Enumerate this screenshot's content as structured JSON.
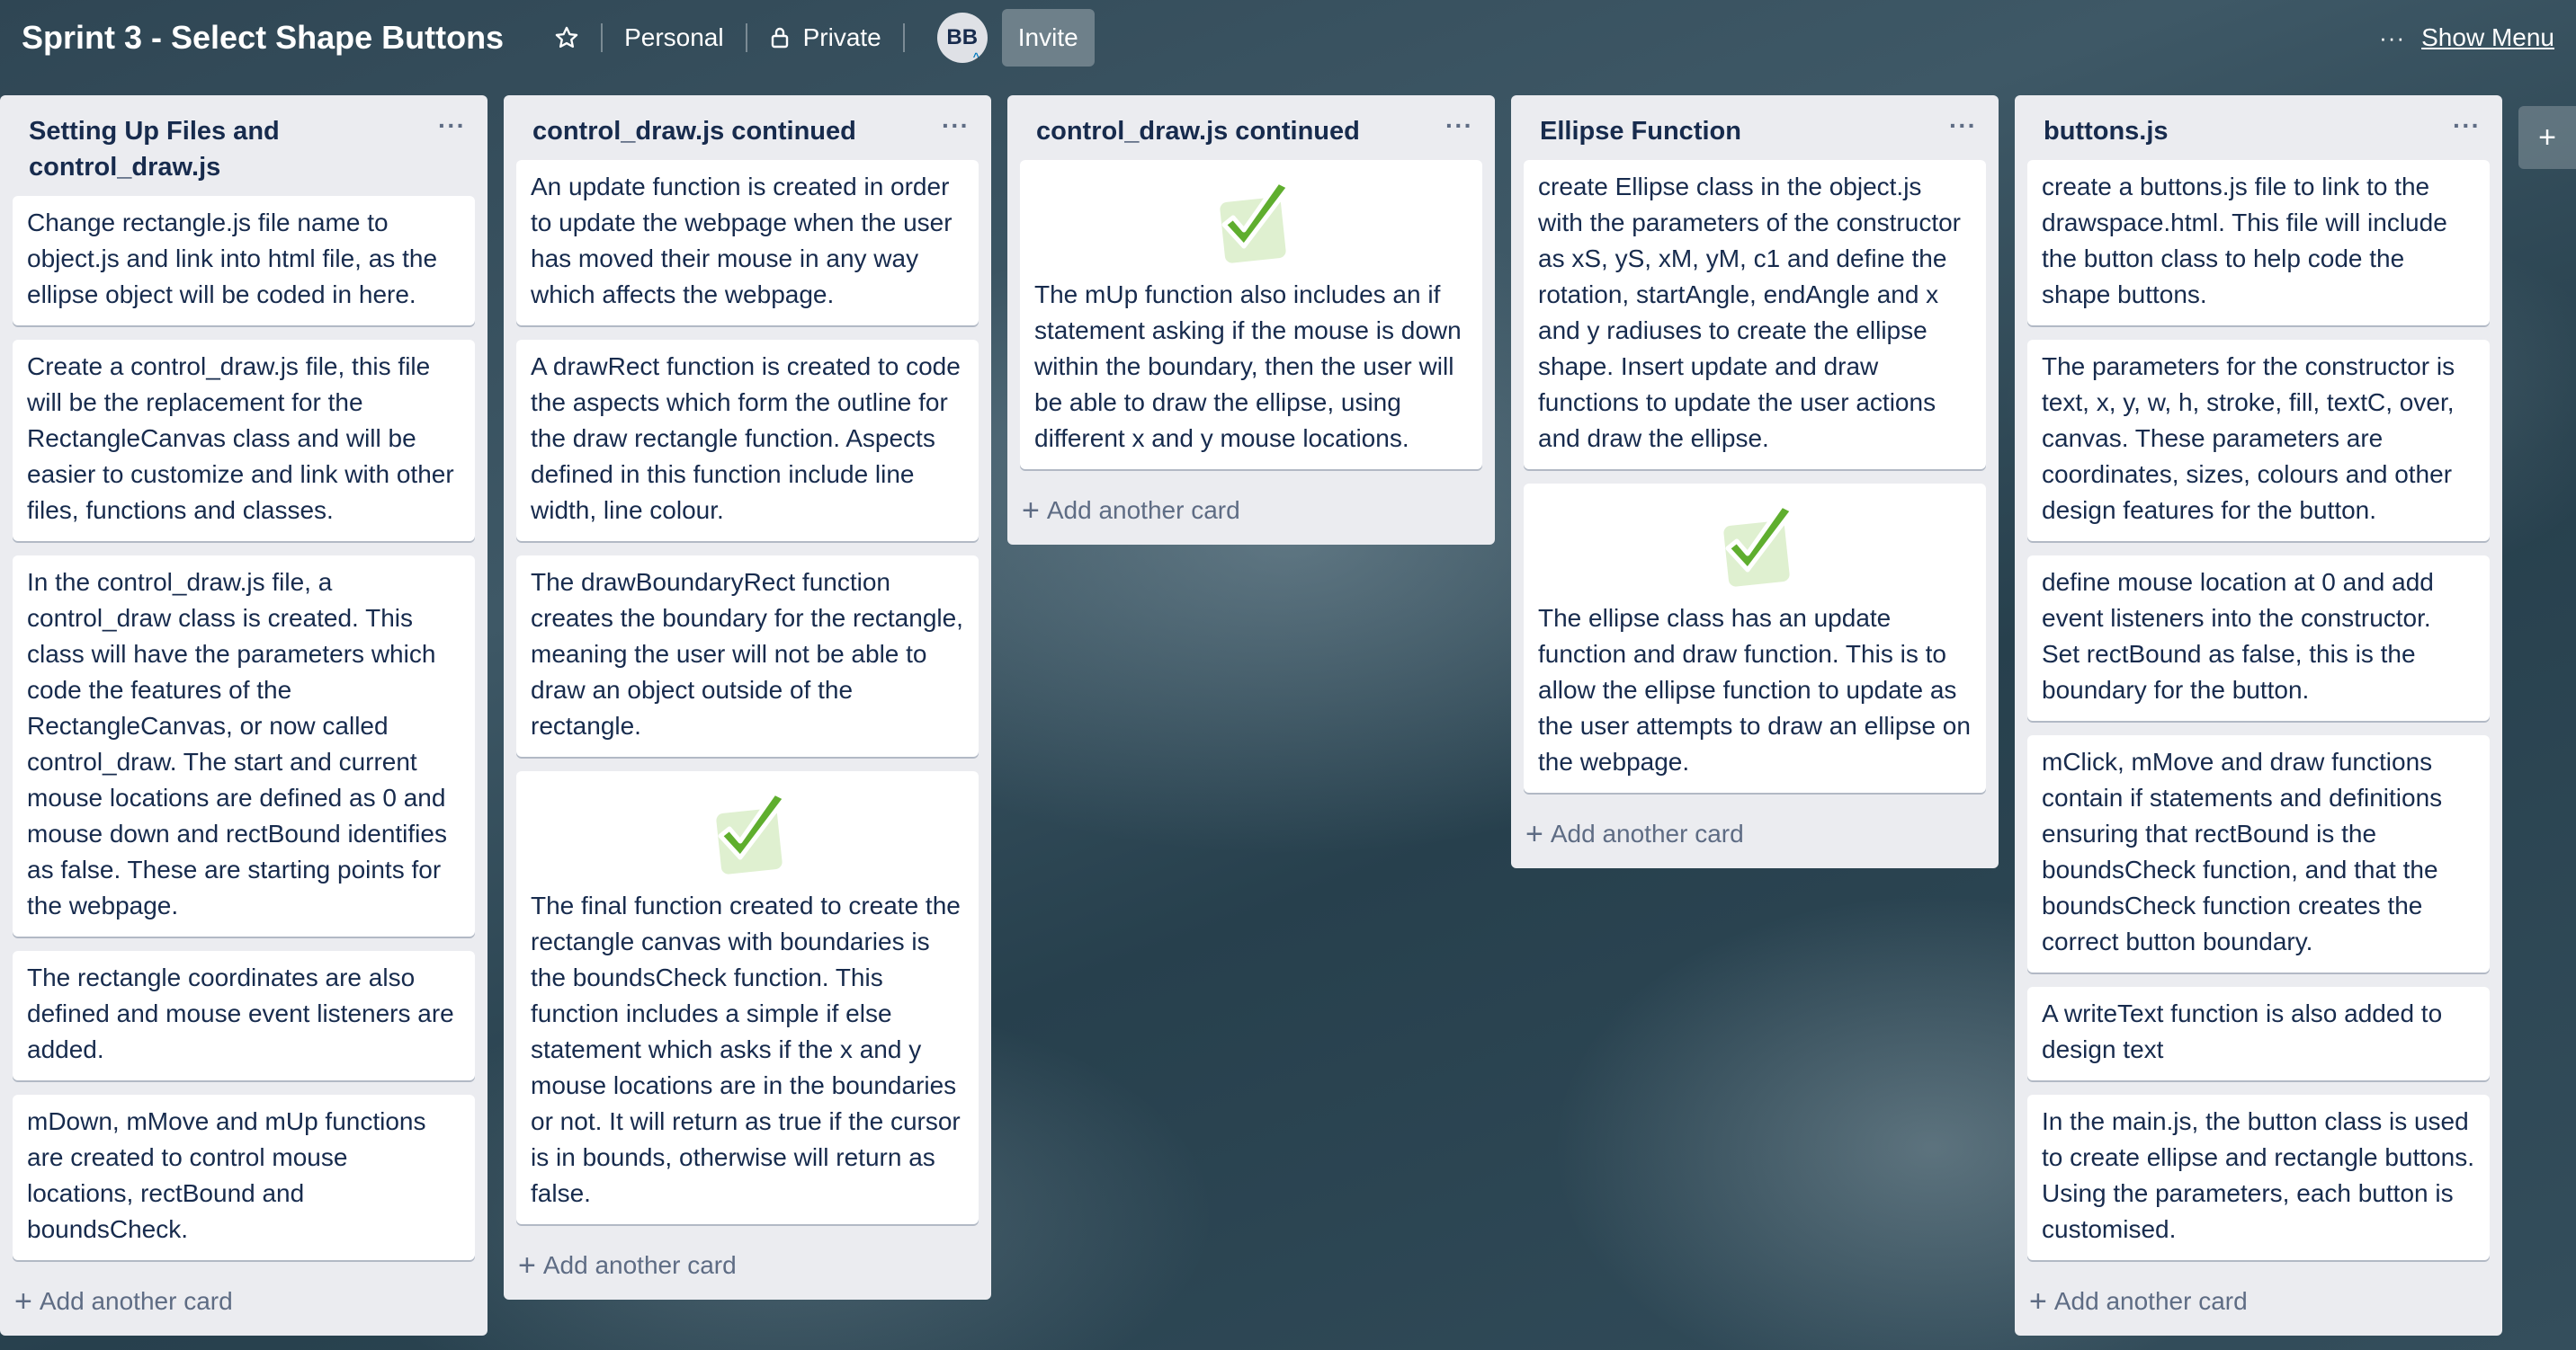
{
  "header": {
    "board_title": "Sprint 3 - Select Shape Buttons",
    "team_label": "Personal",
    "visibility_label": "Private",
    "avatar_initials": "BB",
    "invite_label": "Invite",
    "menu_dots": "···",
    "show_menu_label": "Show Menu"
  },
  "add_card_label": "Add another card",
  "add_list_symbol": "+",
  "lists": [
    {
      "title": "Setting Up Files and control_draw.js",
      "cards": [
        "Change rectangle.js file name to object.js and link into html file, as the ellipse object will be coded in here.",
        "Create a control_draw.js file, this file will be the replacement for the RectangleCanvas class and will be easier to customize and link with other files, functions and classes.",
        "In the control_draw.js file, a control_draw class is created. This class will have the parameters which code the features of the RectangleCanvas, or now called control_draw. The start and current mouse locations are defined as 0 and mouse down and rectBound identifies as false. These are starting points for the webpage.",
        "The rectangle coordinates are also defined and mouse event listeners are added.",
        "mDown, mMove and mUp functions are created to control mouse locations, rectBound and boundsCheck."
      ]
    },
    {
      "title": "control_draw.js continued",
      "cards": [
        "An update function is created in order to update the webpage when the user has moved their mouse in any way which affects the webpage.",
        "A drawRect function is created to code the aspects which form the outline for the draw rectangle function. Aspects defined in this function include line width, line colour.",
        "The drawBoundaryRect function creates the boundary for the rectangle, meaning the user will not be able to draw an object outside of the rectangle.",
        "The final function created to create the rectangle canvas with boundaries is the boundsCheck function. This function includes a simple if else statement which asks if the x and y mouse locations are in the boundaries or not. It will return as true if the cursor is in bounds, otherwise will return as false."
      ]
    },
    {
      "title": "control_draw.js continued",
      "cards": [
        "The mUp function also includes an if statement asking if the mouse is down within the boundary, then the user will be able to draw the ellipse, using different x and y mouse locations."
      ]
    },
    {
      "title": "Ellipse Function",
      "cards": [
        "create Ellipse class in the object.js with the parameters of the constructor as xS, yS, xM, yM, c1 and define the rotation, startAngle, endAngle and x and y radiuses to create the ellipse shape. Insert update and draw functions to update the user actions and draw the ellipse.",
        "The ellipse class has an update function and draw function. This is to allow the ellipse function to update as the user attempts to draw an ellipse on the webpage."
      ]
    },
    {
      "title": "buttons.js",
      "cards": [
        "create a buttons.js file to link to the drawspace.html. This file will include the button class to help code the shape buttons.",
        "The parameters for the constructor is text, x, y, w, h, stroke, fill, textC, over, canvas. These parameters are coordinates, sizes, colours and other design features for the button.",
        "define mouse location at 0 and add event listeners into the constructor. Set rectBound as false, this is the boundary for the button.",
        "mClick, mMove and draw functions contain if statements and definitions ensuring that rectBound is the boundsCheck function, and that the boundsCheck function creates the correct button boundary.",
        "A writeText function is also added to design text",
        "In the main.js, the button class is used to create ellipse and rectangle buttons. Using the parameters, each button is customised."
      ]
    }
  ]
}
